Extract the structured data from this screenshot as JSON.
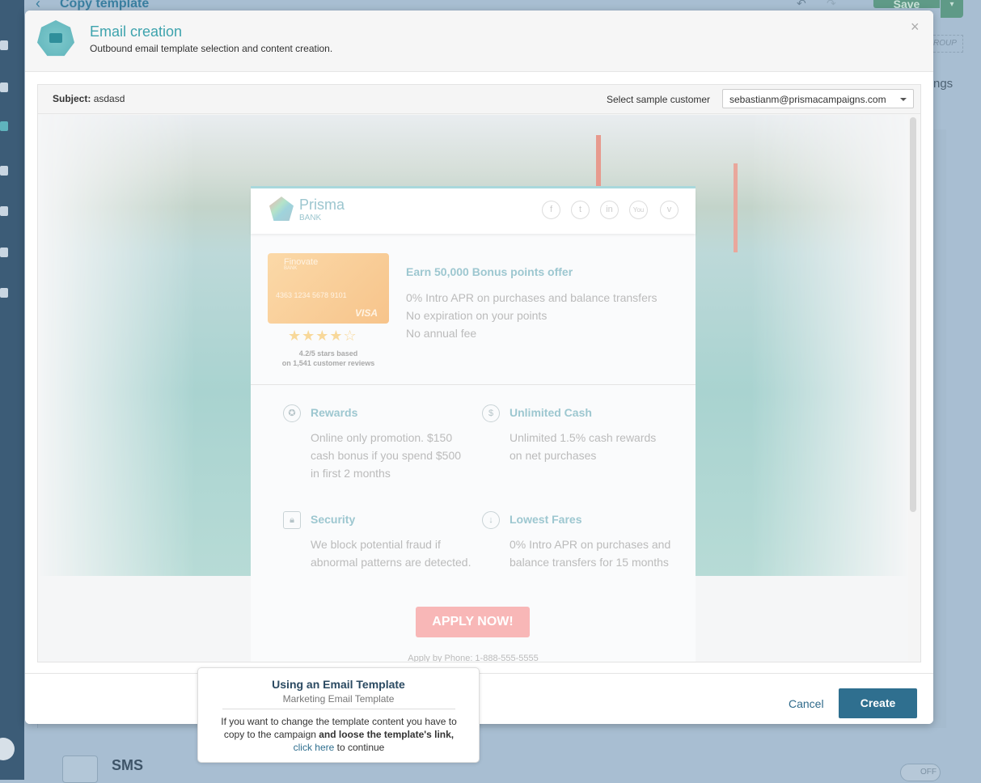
{
  "page": {
    "title": "Copy template",
    "save_label": "Save",
    "group_label": "ROUP",
    "settings_fragment": "ngs",
    "sms_label": "SMS",
    "toggle_label": "OFF"
  },
  "modal": {
    "title": "Email creation",
    "subtitle": "Outbound email template selection and content creation.",
    "subject_label": "Subject:",
    "subject_value": "asdasd",
    "sample_customer_label": "Select sample customer",
    "sample_customer_value": "sebastianm@prismacampaigns.com",
    "cancel_label": "Cancel",
    "create_label": "Create"
  },
  "email": {
    "brand": "Prisma",
    "brand_sub": "BANK",
    "social": [
      "facebook",
      "twitter",
      "linkedin",
      "youtube",
      "vimeo"
    ],
    "card": {
      "issuer": "Finovate",
      "issuer_sub": "BANK",
      "number": "4363  1234  5678  9101",
      "network": "VISA"
    },
    "rating_value": 4.2,
    "rating_max": 5,
    "rating_text_1": "4.2/5 stars based",
    "rating_text_2": "on 1,541 customer reviews",
    "offer_title": "Earn 50,000 Bonus points offer",
    "offer_lines": [
      "0% Intro APR on purchases and balance transfers",
      "No expiration on your points",
      "No annual fee"
    ],
    "features": [
      {
        "title": "Rewards",
        "icon": "medal-icon",
        "body": "Online only promotion. $150 cash bonus if you spend $500 in first 2 months"
      },
      {
        "title": "Unlimited Cash",
        "icon": "cash-icon",
        "body": "Unlimited 1.5% cash rewards on net purchases"
      },
      {
        "title": "Security",
        "icon": "lock-icon",
        "body": "We block potential fraud if abnormal patterns are detected."
      },
      {
        "title": "Lowest Fares",
        "icon": "arrow-down-icon",
        "body": "0% Intro APR on purchases and balance transfers for 15 months"
      }
    ],
    "apply_label": "APPLY NOW!",
    "phone": "Apply by Phone: 1-888-555-5555"
  },
  "tooltip": {
    "title": "Using an Email Template",
    "subtitle": "Marketing Email Template",
    "body_1": "If you want to change the template content you have to copy to the campaign ",
    "body_bold": "and loose the template's link,",
    "link": "click here",
    "body_2": " to continue"
  }
}
